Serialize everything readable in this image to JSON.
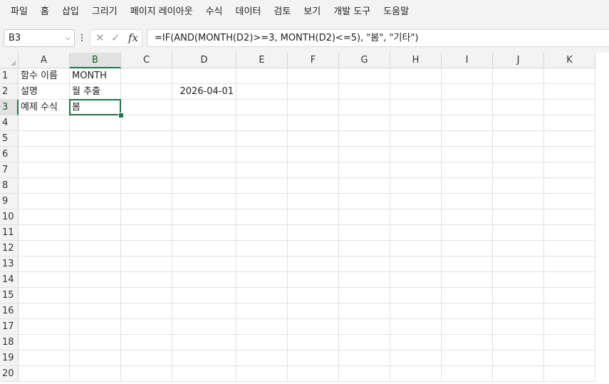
{
  "menu": [
    "파일",
    "홈",
    "삽입",
    "그리기",
    "페이지 레이아웃",
    "수식",
    "데이터",
    "검토",
    "보기",
    "개발 도구",
    "도움말"
  ],
  "formula_bar": {
    "name_box": "B3",
    "formula": "=IF(AND(MONTH(D2)>=3, MONTH(D2)<=5), \"봄\", \"기타\")",
    "fx_label": "fx"
  },
  "columns": [
    "A",
    "B",
    "C",
    "D",
    "E",
    "F",
    "G",
    "H",
    "I",
    "J",
    "K"
  ],
  "rows": [
    "1",
    "2",
    "3",
    "4",
    "5",
    "6",
    "7",
    "8",
    "9",
    "10",
    "11",
    "12",
    "13",
    "14",
    "15",
    "16",
    "17",
    "18",
    "19",
    "20"
  ],
  "cells": {
    "A1": "함수 이름",
    "B1": "MONTH",
    "A2": "설명",
    "B2": "월 추출",
    "D2": "2026-04-01",
    "A3": "예제 수식",
    "B3": "봄"
  },
  "selected_cell": "B3"
}
